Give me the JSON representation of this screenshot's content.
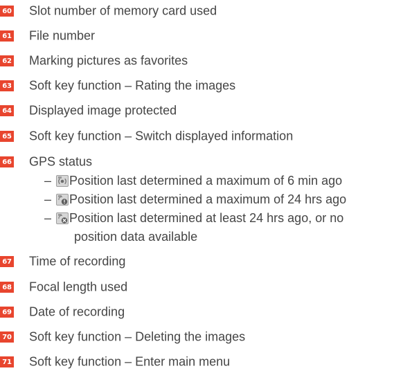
{
  "items": [
    {
      "number": "60",
      "label": "Slot number of memory card used"
    },
    {
      "number": "61",
      "label": "File number"
    },
    {
      "number": "62",
      "label": "Marking pictures as favorites"
    },
    {
      "number": "63",
      "label": "Soft key function – Rating the images"
    },
    {
      "number": "64",
      "label": "Displayed image protected"
    },
    {
      "number": "65",
      "label": "Soft key function – Switch displayed information"
    },
    {
      "number": "66",
      "label": "GPS status"
    },
    {
      "number": "67",
      "label": "Time of recording"
    },
    {
      "number": "68",
      "label": "Focal length used"
    },
    {
      "number": "69",
      "label": "Date of recording"
    },
    {
      "number": "70",
      "label": "Soft key function – Deleting the images"
    },
    {
      "number": "71",
      "label": "Soft key function – Enter main menu"
    }
  ],
  "gps_states": [
    {
      "icon": "gps-signal-icon",
      "text": "Position last determined a maximum of 6 min ago"
    },
    {
      "icon": "gps-warning-icon",
      "text": "Position last determined a maximum of 24 hrs ago"
    },
    {
      "icon": "gps-no-position-icon",
      "text": "Position last determined at least 24 hrs ago, or no",
      "continuation": "position data available"
    }
  ],
  "dash": "–",
  "colors": {
    "badge": "#e8452e",
    "text": "#454545"
  }
}
